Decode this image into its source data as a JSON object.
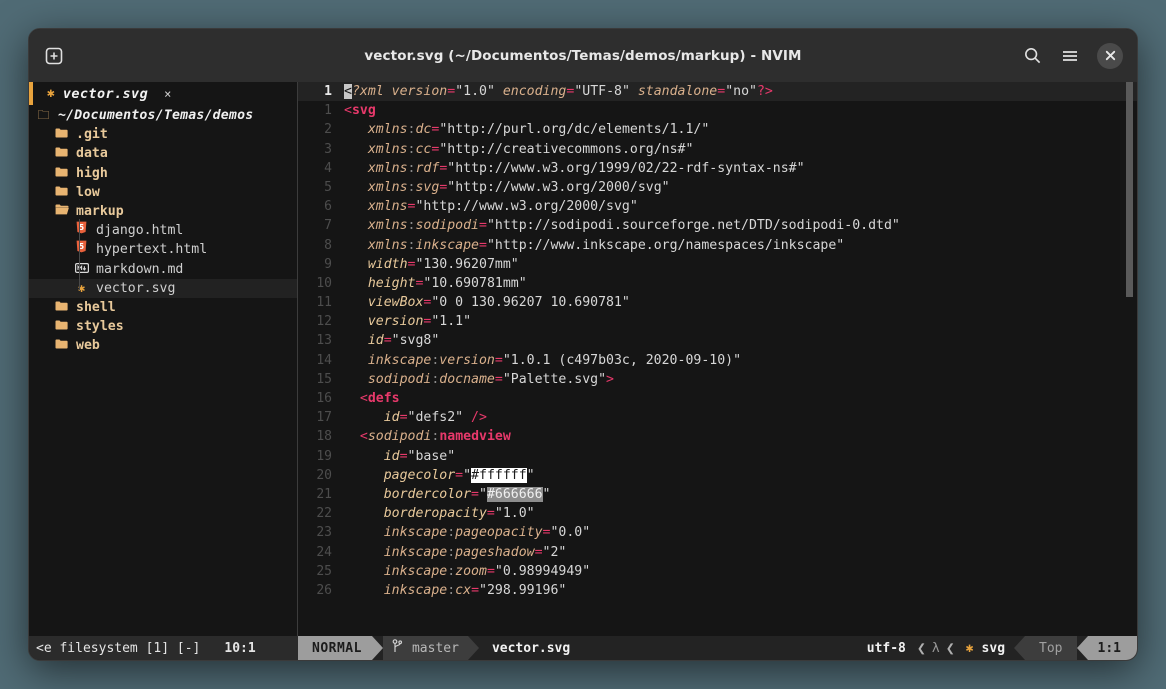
{
  "window": {
    "title": "vector.svg (~/Documentos/Temas/demos/markup) - NVIM",
    "new_tab_icon": "plus-box-icon",
    "search_icon": "search-icon",
    "menu_icon": "hamburger-menu-icon",
    "close_icon": "close-icon",
    "accent_color": "#e8a33d",
    "background_color": "#151515",
    "outer_background": "#506b75"
  },
  "tab": {
    "icon": "svg-asterisk-icon",
    "label": "vector.svg",
    "close_label": "×"
  },
  "sidebar": {
    "root": {
      "label": "~/Documentos/Temas/demos",
      "icon": "folder-open-icon",
      "indent": 0
    },
    "items": [
      {
        "label": ".git",
        "icon": "folder-icon",
        "type": "dir",
        "indent": 1,
        "selected": false
      },
      {
        "label": "data",
        "icon": "folder-icon",
        "type": "dir",
        "indent": 1,
        "selected": false
      },
      {
        "label": "high",
        "icon": "folder-icon",
        "type": "dir",
        "indent": 1,
        "selected": false
      },
      {
        "label": "low",
        "icon": "folder-icon",
        "type": "dir",
        "indent": 1,
        "selected": false
      },
      {
        "label": "markup",
        "icon": "folder-open-icon",
        "type": "dir",
        "indent": 1,
        "selected": false
      },
      {
        "label": "django.html",
        "icon": "html5-icon",
        "type": "file",
        "indent": 2,
        "selected": false
      },
      {
        "label": "hypertext.html",
        "icon": "html5-icon",
        "type": "file",
        "indent": 2,
        "selected": false
      },
      {
        "label": "markdown.md",
        "icon": "markdown-icon",
        "type": "file",
        "indent": 2,
        "selected": false
      },
      {
        "label": "vector.svg",
        "icon": "svg-asterisk-icon",
        "type": "file",
        "indent": 2,
        "selected": true
      },
      {
        "label": "shell",
        "icon": "folder-icon",
        "type": "dir",
        "indent": 1,
        "selected": false
      },
      {
        "label": "styles",
        "icon": "folder-icon",
        "type": "dir",
        "indent": 1,
        "selected": false
      },
      {
        "label": "web",
        "icon": "folder-icon",
        "type": "dir",
        "indent": 1,
        "selected": false
      }
    ]
  },
  "editor": {
    "cursorline_number": "1",
    "lines": [
      {
        "num": "1",
        "cursor": true,
        "parts": [
          {
            "t": "<",
            "c": "tagpunct cursor"
          },
          {
            "t": "?xml version",
            "c": "pi"
          },
          {
            "t": "=",
            "c": "eq"
          },
          {
            "t": "\"1.0\"",
            "c": "str"
          },
          {
            "t": " encoding",
            "c": "pi"
          },
          {
            "t": "=",
            "c": "eq"
          },
          {
            "t": "\"UTF-8\"",
            "c": "str"
          },
          {
            "t": " standalone",
            "c": "pi"
          },
          {
            "t": "=",
            "c": "eq"
          },
          {
            "t": "\"no\"",
            "c": "str"
          },
          {
            "t": "?>",
            "c": "tagpunct"
          }
        ]
      },
      {
        "num": "1",
        "cursor": false,
        "parts": [
          {
            "t": "<",
            "c": "tagpunct"
          },
          {
            "t": "svg",
            "c": "tag"
          }
        ]
      },
      {
        "num": "2",
        "cursor": false,
        "parts": [
          {
            "t": "   xmlns",
            "c": "ns"
          },
          {
            "t": ":",
            "c": "nscolon"
          },
          {
            "t": "dc",
            "c": "ns"
          },
          {
            "t": "=",
            "c": "eq"
          },
          {
            "t": "\"http://purl.org/dc/elements/1.1/\"",
            "c": "str"
          }
        ]
      },
      {
        "num": "3",
        "cursor": false,
        "parts": [
          {
            "t": "   xmlns",
            "c": "ns"
          },
          {
            "t": ":",
            "c": "nscolon"
          },
          {
            "t": "cc",
            "c": "ns"
          },
          {
            "t": "=",
            "c": "eq"
          },
          {
            "t": "\"http://creativecommons.org/ns#\"",
            "c": "str"
          }
        ]
      },
      {
        "num": "4",
        "cursor": false,
        "parts": [
          {
            "t": "   xmlns",
            "c": "ns"
          },
          {
            "t": ":",
            "c": "nscolon"
          },
          {
            "t": "rdf",
            "c": "ns"
          },
          {
            "t": "=",
            "c": "eq"
          },
          {
            "t": "\"http://www.w3.org/1999/02/22-rdf-syntax-ns#\"",
            "c": "str"
          }
        ]
      },
      {
        "num": "5",
        "cursor": false,
        "parts": [
          {
            "t": "   xmlns",
            "c": "ns"
          },
          {
            "t": ":",
            "c": "nscolon"
          },
          {
            "t": "svg",
            "c": "ns"
          },
          {
            "t": "=",
            "c": "eq"
          },
          {
            "t": "\"http://www.w3.org/2000/svg\"",
            "c": "str"
          }
        ]
      },
      {
        "num": "6",
        "cursor": false,
        "parts": [
          {
            "t": "   xmlns",
            "c": "ns"
          },
          {
            "t": "=",
            "c": "eq"
          },
          {
            "t": "\"http://www.w3.org/2000/svg\"",
            "c": "str"
          }
        ]
      },
      {
        "num": "7",
        "cursor": false,
        "parts": [
          {
            "t": "   xmlns",
            "c": "ns"
          },
          {
            "t": ":",
            "c": "nscolon"
          },
          {
            "t": "sodipodi",
            "c": "ns"
          },
          {
            "t": "=",
            "c": "eq"
          },
          {
            "t": "\"http://sodipodi.sourceforge.net/DTD/sodipodi-0.dtd\"",
            "c": "str"
          }
        ]
      },
      {
        "num": "8",
        "cursor": false,
        "parts": [
          {
            "t": "   xmlns",
            "c": "ns"
          },
          {
            "t": ":",
            "c": "nscolon"
          },
          {
            "t": "inkscape",
            "c": "ns"
          },
          {
            "t": "=",
            "c": "eq"
          },
          {
            "t": "\"http://www.inkscape.org/namespaces/inkscape\"",
            "c": "str"
          }
        ]
      },
      {
        "num": "9",
        "cursor": false,
        "parts": [
          {
            "t": "   width",
            "c": "attr"
          },
          {
            "t": "=",
            "c": "eq"
          },
          {
            "t": "\"130.96207mm\"",
            "c": "str"
          }
        ]
      },
      {
        "num": "10",
        "cursor": false,
        "parts": [
          {
            "t": "   height",
            "c": "attr"
          },
          {
            "t": "=",
            "c": "eq"
          },
          {
            "t": "\"10.690781mm\"",
            "c": "str"
          }
        ]
      },
      {
        "num": "11",
        "cursor": false,
        "parts": [
          {
            "t": "   viewBox",
            "c": "attr"
          },
          {
            "t": "=",
            "c": "eq"
          },
          {
            "t": "\"0 0 130.96207 10.690781\"",
            "c": "str"
          }
        ]
      },
      {
        "num": "12",
        "cursor": false,
        "parts": [
          {
            "t": "   version",
            "c": "attr"
          },
          {
            "t": "=",
            "c": "eq"
          },
          {
            "t": "\"1.1\"",
            "c": "str"
          }
        ]
      },
      {
        "num": "13",
        "cursor": false,
        "parts": [
          {
            "t": "   id",
            "c": "attr"
          },
          {
            "t": "=",
            "c": "eq"
          },
          {
            "t": "\"svg8\"",
            "c": "str"
          }
        ]
      },
      {
        "num": "14",
        "cursor": false,
        "parts": [
          {
            "t": "   inkscape",
            "c": "ns"
          },
          {
            "t": ":",
            "c": "nscolon"
          },
          {
            "t": "version",
            "c": "ns"
          },
          {
            "t": "=",
            "c": "eq"
          },
          {
            "t": "\"1.0.1 (c497b03c, 2020-09-10)\"",
            "c": "str"
          }
        ]
      },
      {
        "num": "15",
        "cursor": false,
        "parts": [
          {
            "t": "   sodipodi",
            "c": "ns"
          },
          {
            "t": ":",
            "c": "nscolon"
          },
          {
            "t": "docname",
            "c": "ns"
          },
          {
            "t": "=",
            "c": "eq"
          },
          {
            "t": "\"Palette.svg\"",
            "c": "str"
          },
          {
            "t": ">",
            "c": "tagpunct"
          }
        ]
      },
      {
        "num": "16",
        "cursor": false,
        "parts": [
          {
            "t": "  <",
            "c": "tagpunct"
          },
          {
            "t": "defs",
            "c": "tag"
          }
        ]
      },
      {
        "num": "17",
        "cursor": false,
        "parts": [
          {
            "t": "     id",
            "c": "attr"
          },
          {
            "t": "=",
            "c": "eq"
          },
          {
            "t": "\"defs2\"",
            "c": "str"
          },
          {
            "t": " />",
            "c": "tagpunct"
          }
        ]
      },
      {
        "num": "18",
        "cursor": false,
        "parts": [
          {
            "t": "  <",
            "c": "tagpunct"
          },
          {
            "t": "sodipodi",
            "c": "ns"
          },
          {
            "t": ":",
            "c": "nscolon"
          },
          {
            "t": "namedview",
            "c": "tag"
          }
        ]
      },
      {
        "num": "19",
        "cursor": false,
        "parts": [
          {
            "t": "     id",
            "c": "attr"
          },
          {
            "t": "=",
            "c": "eq"
          },
          {
            "t": "\"base\"",
            "c": "str"
          }
        ]
      },
      {
        "num": "20",
        "cursor": false,
        "parts": [
          {
            "t": "     pagecolor",
            "c": "attr"
          },
          {
            "t": "=",
            "c": "eq"
          },
          {
            "t": "\"",
            "c": "str"
          },
          {
            "t": "#ffffff",
            "c": "hl-white"
          },
          {
            "t": "\"",
            "c": "str"
          }
        ]
      },
      {
        "num": "21",
        "cursor": false,
        "parts": [
          {
            "t": "     bordercolor",
            "c": "attr"
          },
          {
            "t": "=",
            "c": "eq"
          },
          {
            "t": "\"",
            "c": "str"
          },
          {
            "t": "#666666",
            "c": "hl-gray"
          },
          {
            "t": "\"",
            "c": "str"
          }
        ]
      },
      {
        "num": "22",
        "cursor": false,
        "parts": [
          {
            "t": "     borderopacity",
            "c": "attr"
          },
          {
            "t": "=",
            "c": "eq"
          },
          {
            "t": "\"1.0\"",
            "c": "str"
          }
        ]
      },
      {
        "num": "23",
        "cursor": false,
        "parts": [
          {
            "t": "     inkscape",
            "c": "ns"
          },
          {
            "t": ":",
            "c": "nscolon"
          },
          {
            "t": "pageopacity",
            "c": "ns"
          },
          {
            "t": "=",
            "c": "eq"
          },
          {
            "t": "\"0.0\"",
            "c": "str"
          }
        ]
      },
      {
        "num": "24",
        "cursor": false,
        "parts": [
          {
            "t": "     inkscape",
            "c": "ns"
          },
          {
            "t": ":",
            "c": "nscolon"
          },
          {
            "t": "pageshadow",
            "c": "ns"
          },
          {
            "t": "=",
            "c": "eq"
          },
          {
            "t": "\"2\"",
            "c": "str"
          }
        ]
      },
      {
        "num": "25",
        "cursor": false,
        "parts": [
          {
            "t": "     inkscape",
            "c": "ns"
          },
          {
            "t": ":",
            "c": "nscolon"
          },
          {
            "t": "zoom",
            "c": "ns"
          },
          {
            "t": "=",
            "c": "eq"
          },
          {
            "t": "\"0.98994949\"",
            "c": "str"
          }
        ]
      },
      {
        "num": "26",
        "cursor": false,
        "parts": [
          {
            "t": "     inkscape",
            "c": "ns"
          },
          {
            "t": ":",
            "c": "nscolon"
          },
          {
            "t": "cx",
            "c": "ns"
          },
          {
            "t": "=",
            "c": "eq"
          },
          {
            "t": "\"298.99196\"",
            "c": "str"
          }
        ]
      }
    ]
  },
  "statusline": {
    "left_text": "<e filesystem [1] [-]",
    "left_position": "10:1",
    "mode": "NORMAL",
    "git_icon": "git-branch-icon",
    "branch": "master",
    "filename": "vector.svg",
    "encoding": "utf-8",
    "lsp_icon": "lambda-icon",
    "filetype_icon": "svg-asterisk-icon",
    "filetype": "svg",
    "scroll_position": "Top",
    "cursor_position": "1:1"
  }
}
